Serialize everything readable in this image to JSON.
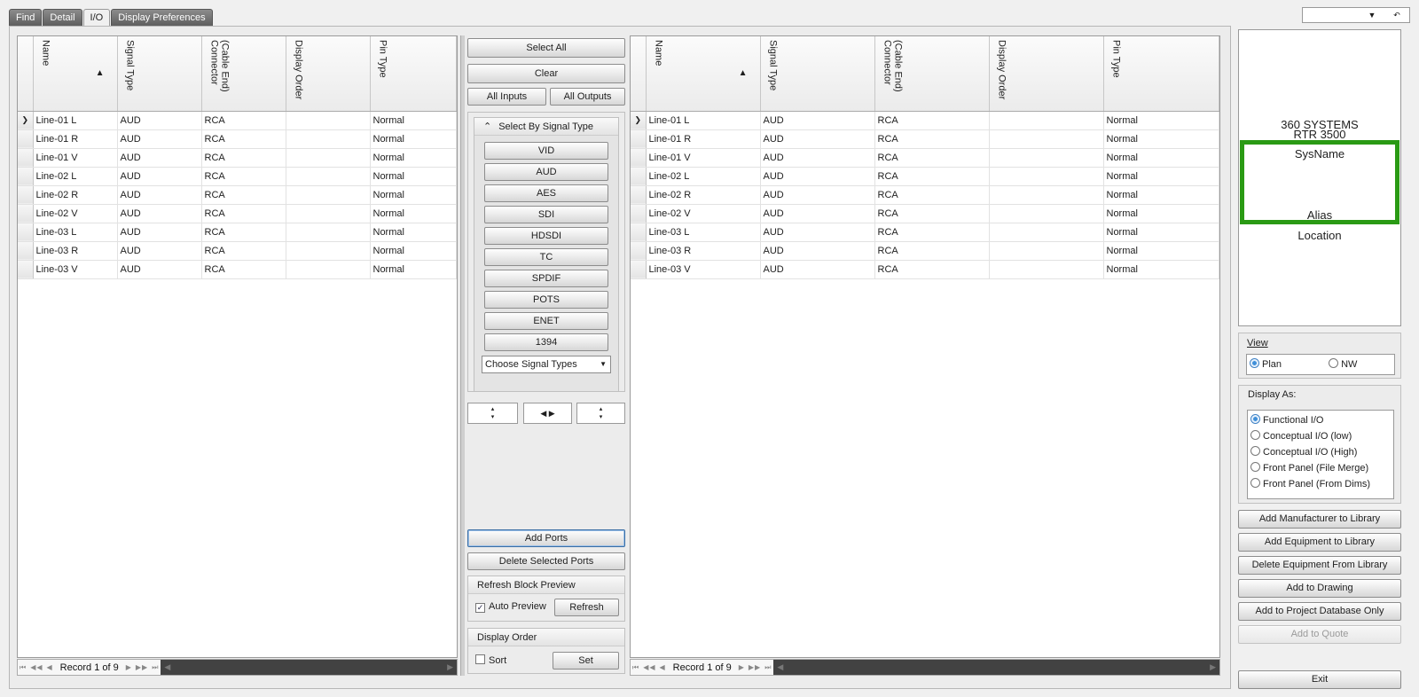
{
  "tabs": [
    "Find",
    "Detail",
    "I/O",
    "Display Preferences"
  ],
  "active_tab": "I/O",
  "top_combo": {
    "arrow": "▼",
    "undo": "↶"
  },
  "columns": [
    {
      "label": "Name",
      "sorted": "▲"
    },
    {
      "label": "Signal Type"
    },
    {
      "label": "(Cable End)\nConnector"
    },
    {
      "label": "Display Order"
    },
    {
      "label": "Pin Type"
    }
  ],
  "rows": [
    {
      "indicator": "❯",
      "name": "Line-01 L",
      "signal": "AUD",
      "connector": "RCA",
      "order": "",
      "pin": "Normal"
    },
    {
      "indicator": "",
      "name": "Line-01 R",
      "signal": "AUD",
      "connector": "RCA",
      "order": "",
      "pin": "Normal"
    },
    {
      "indicator": "",
      "name": "Line-01 V",
      "signal": "AUD",
      "connector": "RCA",
      "order": "",
      "pin": "Normal"
    },
    {
      "indicator": "",
      "name": "Line-02 L",
      "signal": "AUD",
      "connector": "RCA",
      "order": "",
      "pin": "Normal"
    },
    {
      "indicator": "",
      "name": "Line-02 R",
      "signal": "AUD",
      "connector": "RCA",
      "order": "",
      "pin": "Normal"
    },
    {
      "indicator": "",
      "name": "Line-02 V",
      "signal": "AUD",
      "connector": "RCA",
      "order": "",
      "pin": "Normal"
    },
    {
      "indicator": "",
      "name": "Line-03 L",
      "signal": "AUD",
      "connector": "RCA",
      "order": "",
      "pin": "Normal"
    },
    {
      "indicator": "",
      "name": "Line-03 R",
      "signal": "AUD",
      "connector": "RCA",
      "order": "",
      "pin": "Normal"
    },
    {
      "indicator": "",
      "name": "Line-03 V",
      "signal": "AUD",
      "connector": "RCA",
      "order": "",
      "pin": "Normal"
    }
  ],
  "pager": {
    "first": "⏮",
    "prev_page": "◀◀",
    "prev": "◀",
    "record_text": "Record 1 of 9",
    "next": "▶",
    "next_page": "▶▶",
    "last": "⏭",
    "scroll_left": "◀",
    "scroll_right": "▶"
  },
  "middle": {
    "select_all": "Select All",
    "clear": "Clear",
    "all_inputs": "All Inputs",
    "all_outputs": "All Outputs",
    "signal_group_title": "Select By Signal Type",
    "signal_group_collapse": "⌃",
    "signal_types": [
      "VID",
      "AUD",
      "AES",
      "SDI",
      "HDSDI",
      "TC",
      "SPDIF",
      "POTS",
      "ENET",
      "1394"
    ],
    "choose_signal_types": "Choose Signal Types",
    "spin_up_down": "▴\n▾",
    "spin_left_right": "◀  ▶",
    "add_ports": "Add Ports",
    "delete_selected_ports": "Delete Selected Ports",
    "refresh_block_preview": "Refresh Block Preview",
    "auto_preview_label": "Auto Preview",
    "auto_preview_checked": "✓",
    "refresh": "Refresh",
    "display_order": "Display Order",
    "sort_label": "Sort",
    "set": "Set"
  },
  "preview": {
    "manufacturer": "360 SYSTEMS",
    "model": "RTR 3500",
    "sysname": "SysName",
    "alias": "Alias",
    "location": "Location",
    "highlight_color": "#2a9a14"
  },
  "view": {
    "title": "View",
    "options": [
      "Plan",
      "NW"
    ],
    "selected": "Plan"
  },
  "display_as": {
    "title": "Display As:",
    "options": [
      "Functional I/O",
      "Conceptual I/O (low)",
      "Conceptual I/O (High)",
      "Front Panel (File Merge)",
      "Front Panel (From Dims)"
    ],
    "selected": "Functional I/O"
  },
  "actions": {
    "add_manufacturer": "Add Manufacturer to Library",
    "add_equipment": "Add Equipment to Library",
    "delete_equipment": "Delete Equipment From Library",
    "add_to_drawing": "Add to Drawing",
    "add_to_project_db": "Add to Project Database Only",
    "add_to_quote": "Add to Quote",
    "exit": "Exit"
  }
}
